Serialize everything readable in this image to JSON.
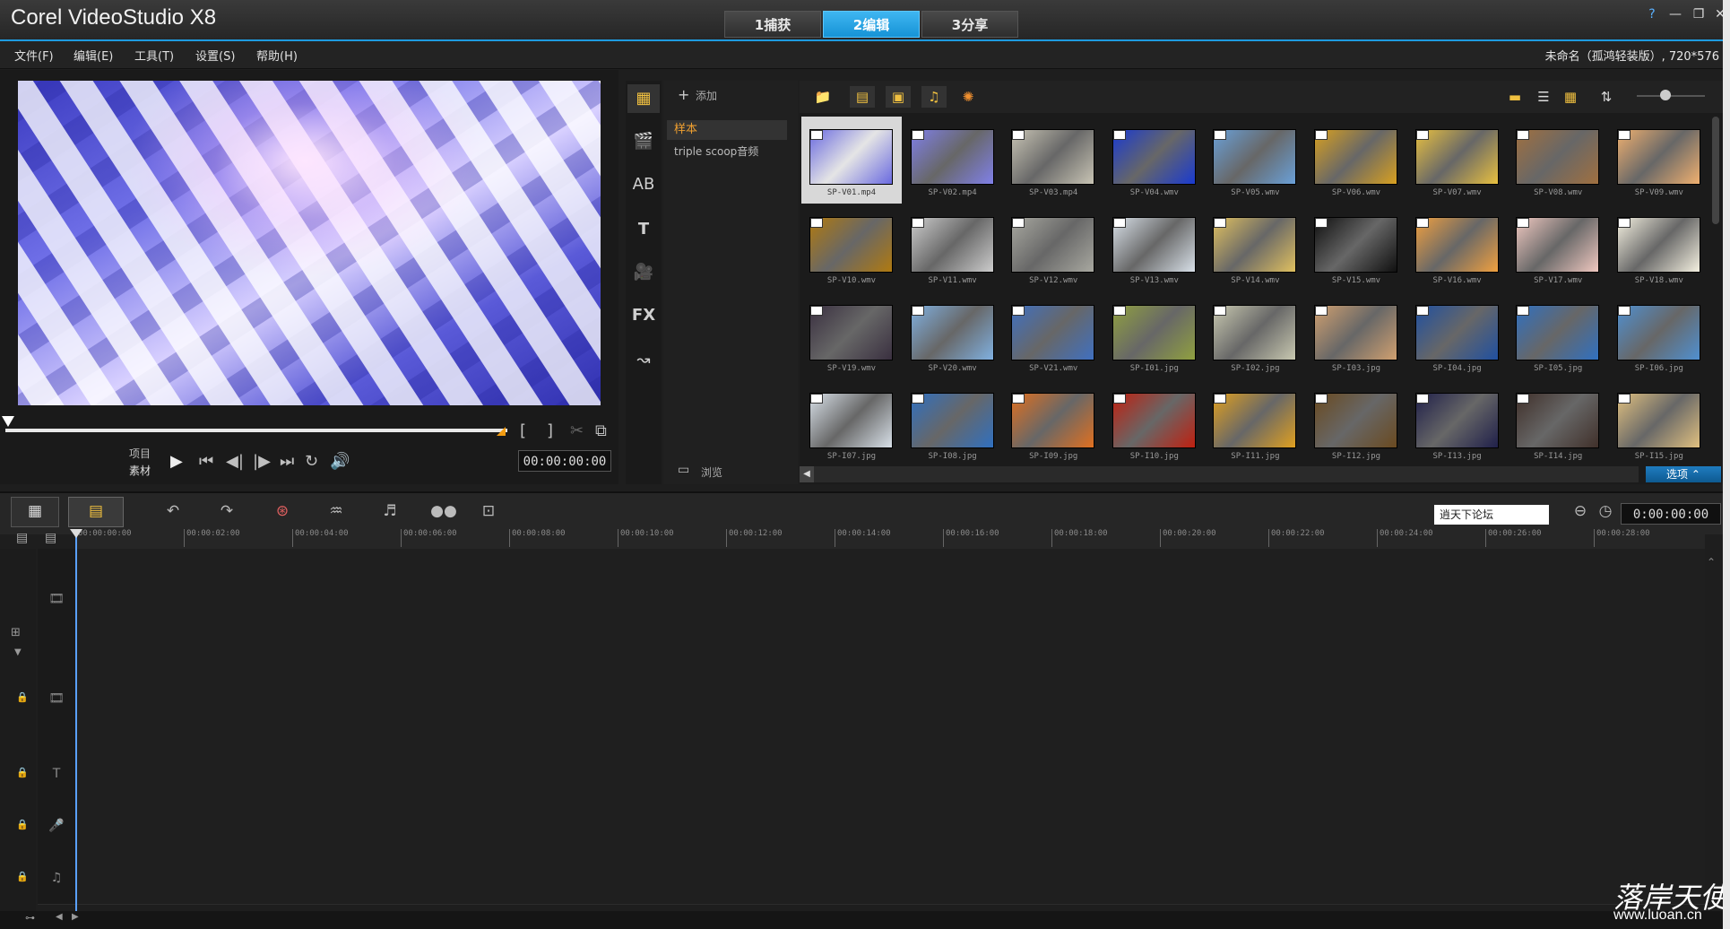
{
  "app": {
    "title": "Corel VideoStudio X8"
  },
  "steps": [
    {
      "label": "1捕获",
      "active": false
    },
    {
      "label": "2编辑",
      "active": true
    },
    {
      "label": "3分享",
      "active": false
    }
  ],
  "window_buttons": {
    "help": "?",
    "minimize": "—",
    "restore": "❐",
    "close": "✕"
  },
  "menu": [
    "文件(F)",
    "编辑(E)",
    "工具(T)",
    "设置(S)",
    "帮助(H)"
  ],
  "project_info": "未命名（孤鸿轻装版）, 720*576",
  "player": {
    "project_label": "项目",
    "clip_label": "素材",
    "timecode": "00:00:00:00",
    "mark_in": "[",
    "mark_out": "]"
  },
  "library": {
    "add_label": "添加",
    "folders": [
      "样本",
      "triple scoop音频"
    ],
    "browse_label": "浏览",
    "options_label": "选项",
    "thumbnails": [
      {
        "name": "SP-V01.mp4",
        "color": "#6a6ae0"
      },
      {
        "name": "SP-V02.mp4",
        "color": "#8080e8"
      },
      {
        "name": "SP-V03.mp4",
        "color": "#c8c4b4"
      },
      {
        "name": "SP-V04.wmv",
        "color": "#1a3ad0"
      },
      {
        "name": "SP-V05.wmv",
        "color": "#6aa0d8"
      },
      {
        "name": "SP-V06.wmv",
        "color": "#d8a020"
      },
      {
        "name": "SP-V07.wmv",
        "color": "#e8c040"
      },
      {
        "name": "SP-V08.wmv",
        "color": "#a07040"
      },
      {
        "name": "SP-V09.wmv",
        "color": "#f0b070"
      },
      {
        "name": "SP-V10.wmv",
        "color": "#b07a10"
      },
      {
        "name": "SP-V11.wmv",
        "color": "#cccccc"
      },
      {
        "name": "SP-V12.wmv",
        "color": "#a8a8a0"
      },
      {
        "name": "SP-V13.wmv",
        "color": "#d8e0e8"
      },
      {
        "name": "SP-V14.wmv",
        "color": "#e0c060"
      },
      {
        "name": "SP-V15.wmv",
        "color": "#101010"
      },
      {
        "name": "SP-V16.wmv",
        "color": "#f0a040"
      },
      {
        "name": "SP-V17.wmv",
        "color": "#f0c8c0"
      },
      {
        "name": "SP-V18.wmv",
        "color": "#f4f0e0"
      },
      {
        "name": "SP-V19.wmv",
        "color": "#3a3040"
      },
      {
        "name": "SP-V20.wmv",
        "color": "#80b0e0"
      },
      {
        "name": "SP-V21.wmv",
        "color": "#4070c0"
      },
      {
        "name": "SP-I01.jpg",
        "color": "#90a040"
      },
      {
        "name": "SP-I02.jpg",
        "color": "#c8c8b0"
      },
      {
        "name": "SP-I03.jpg",
        "color": "#d0a070"
      },
      {
        "name": "SP-I04.jpg",
        "color": "#2050a0"
      },
      {
        "name": "SP-I05.jpg",
        "color": "#3070c0"
      },
      {
        "name": "SP-I06.jpg",
        "color": "#5090d0"
      },
      {
        "name": "SP-I07.jpg",
        "color": "#d8e0e8"
      },
      {
        "name": "SP-I08.jpg",
        "color": "#3070c0"
      },
      {
        "name": "SP-I09.jpg",
        "color": "#e07020"
      },
      {
        "name": "SP-I10.jpg",
        "color": "#c02010"
      },
      {
        "name": "SP-I11.jpg",
        "color": "#e0a020"
      },
      {
        "name": "SP-I12.jpg",
        "color": "#6a4a20"
      },
      {
        "name": "SP-I13.jpg",
        "color": "#20204a"
      },
      {
        "name": "SP-I14.jpg",
        "color": "#40302a"
      },
      {
        "name": "SP-I15.jpg",
        "color": "#e0c080"
      }
    ]
  },
  "timeline": {
    "project_box": "逍天下论坛",
    "timecode": "0:00:00:00",
    "ruler_ticks": [
      "00:00:00:00",
      "00:00:02:00",
      "00:00:04:00",
      "00:00:06:00",
      "00:00:08:00",
      "00:00:10:00",
      "00:00:12:00",
      "00:00:14:00",
      "00:00:16:00",
      "00:00:18:00",
      "00:00:20:00",
      "00:00:22:00",
      "00:00:24:00",
      "00:00:26:00",
      "00:00:28:00"
    ],
    "tracks": [
      {
        "name": "video-track",
        "icon": "🎞"
      },
      {
        "name": "overlay-track",
        "icon": "🎞"
      },
      {
        "name": "title-track",
        "icon": "T"
      },
      {
        "name": "voice-track",
        "icon": "🎤"
      },
      {
        "name": "music-track",
        "icon": "♫"
      }
    ]
  },
  "watermark": {
    "logo": "落岸天使",
    "url": "www.luoan.cn"
  }
}
